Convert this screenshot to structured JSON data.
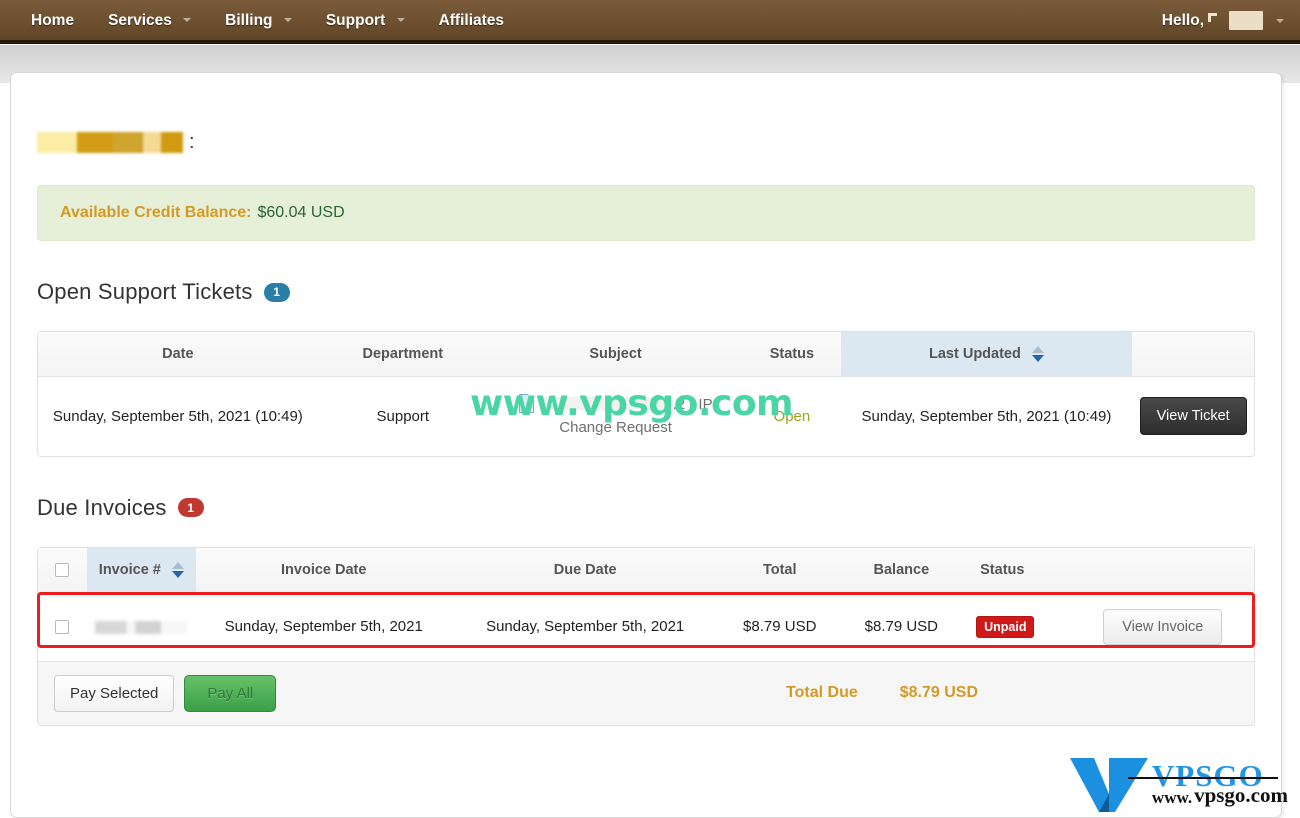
{
  "navbar": {
    "items": [
      {
        "label": "Home",
        "has_caret": false
      },
      {
        "label": "Services",
        "has_caret": true
      },
      {
        "label": "Billing",
        "has_caret": true
      },
      {
        "label": "Support",
        "has_caret": true
      },
      {
        "label": "Affiliates",
        "has_caret": false
      }
    ],
    "greeting": "Hello,",
    "username": "[redacted]",
    "background_color": "#6d502f"
  },
  "page": {
    "title_redacted": "[redacted client name]",
    "title_colon": ":"
  },
  "credit": {
    "label": "Available Credit Balance:",
    "value": "$60.04 USD",
    "label_color": "#d49a25",
    "value_color": "#29662e",
    "background_color": "#e6f0d9"
  },
  "tickets": {
    "heading": "Open Support Tickets",
    "count": "1",
    "badge_color": "#2a7ea8",
    "columns": [
      "Date",
      "Department",
      "Subject",
      "Status",
      "Last Updated",
      ""
    ],
    "sorted_column": "Last Updated",
    "sort_direction": "desc",
    "rows": [
      {
        "date": "Sunday, September 5th, 2021 (10:49)",
        "department": "Support",
        "subject_icon": "document-icon",
        "subject_redacted": "[redacted]",
        "subject_visible": ".2 - IP Change Request",
        "status": "Open",
        "status_color": "#95a516",
        "last_updated": "Sunday, September 5th, 2021 (10:49)",
        "action_label": "View Ticket"
      }
    ]
  },
  "invoices": {
    "heading": "Due Invoices",
    "count": "1",
    "badge_color": "#c0392f",
    "columns": [
      "",
      "Invoice #",
      "Invoice Date",
      "Due Date",
      "Total",
      "Balance",
      "Status",
      ""
    ],
    "sorted_column": "Invoice #",
    "sort_direction": "desc",
    "rows": [
      {
        "invoice_number_redacted": "[redacted]",
        "invoice_date": "Sunday, September 5th, 2021",
        "due_date": "Sunday, September 5th, 2021",
        "total": "$8.79 USD",
        "balance": "$8.79 USD",
        "status": "Unpaid",
        "status_color": "#d01a1a",
        "action_label": "View Invoice",
        "highlighted": true,
        "highlight_color": "#ee1c1c"
      }
    ],
    "footer": {
      "pay_selected_label": "Pay Selected",
      "pay_all_label": "Pay All",
      "total_due_label": "Total Due",
      "total_due_value": "$8.79 USD",
      "total_color": "#d49a25"
    }
  },
  "watermarks": {
    "center_text": "www.vpsgo.com",
    "center_color": "#4ad5a5",
    "logo_brand": "VPSGO",
    "logo_www": "www.",
    "logo_domain": "vpsgo.com",
    "logo_color": "#2196e8"
  }
}
